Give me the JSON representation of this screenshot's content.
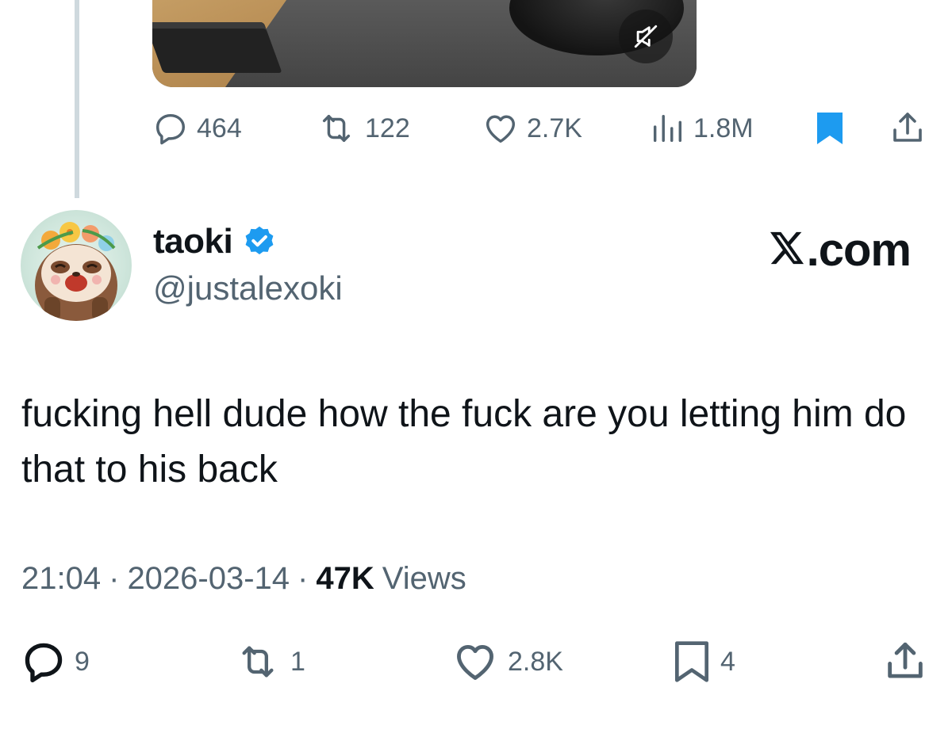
{
  "parent_tweet": {
    "actions": {
      "replies": "464",
      "retweets": "122",
      "likes": "2.7K",
      "views": "1.8M"
    }
  },
  "tweet": {
    "display_name": "taoki",
    "handle": "@justalexoki",
    "site_label": ".com",
    "text": "fucking hell dude how the fuck are you letting him do that to his back",
    "time": "21:04",
    "date": "2026-03-14",
    "views_count": "47K",
    "views_label": "Views",
    "actions": {
      "replies": "9",
      "retweets": "1",
      "likes": "2.8K",
      "bookmarks": "4"
    }
  },
  "colors": {
    "text_primary": "#0f1419",
    "text_secondary": "#536471",
    "accent_blue": "#1d9bf0",
    "thread_line": "#cfd9de"
  }
}
